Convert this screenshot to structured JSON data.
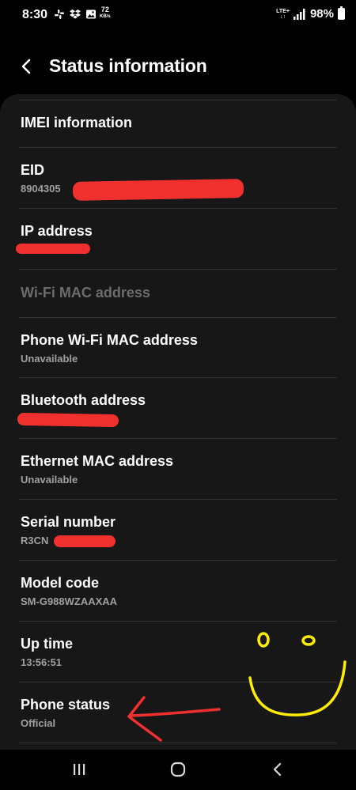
{
  "status_bar": {
    "time": "8:30",
    "speed_value": "72",
    "speed_unit": "KB/s",
    "network": "LTE+",
    "battery": "98%",
    "icons": [
      "slack-icon",
      "dropbox-icon",
      "gallery-icon",
      "speed-icon",
      "network-lte-icon",
      "signal-icon",
      "battery-icon"
    ]
  },
  "header": {
    "title": "Status information",
    "back_icon": "chevron-left-icon"
  },
  "items": [
    {
      "title": "IMEI information",
      "value": ""
    },
    {
      "title": "EID",
      "value": "8904305"
    },
    {
      "title": "IP address",
      "value": ""
    },
    {
      "title": "Wi-Fi MAC address",
      "value": "",
      "disabled": true
    },
    {
      "title": "Phone Wi-Fi MAC address",
      "value": "Unavailable"
    },
    {
      "title": "Bluetooth address",
      "value": ""
    },
    {
      "title": "Ethernet MAC address",
      "value": "Unavailable"
    },
    {
      "title": "Serial number",
      "value": "R3CN"
    },
    {
      "title": "Model code",
      "value": "SM-G988WZAAXAA"
    },
    {
      "title": "Up time",
      "value": "13:56:51"
    },
    {
      "title": "Phone status",
      "value": "Official"
    }
  ],
  "nav": {
    "recents_icon": "recents-icon",
    "home_icon": "home-icon",
    "back_icon": "back-icon"
  },
  "colors": {
    "background": "#000000",
    "card": "#171717",
    "divider": "#323232",
    "secondary_text": "#a0a0a0",
    "disabled_text": "#6c6c6c",
    "redaction": "#f0302f",
    "smiley": "#ffec00"
  }
}
